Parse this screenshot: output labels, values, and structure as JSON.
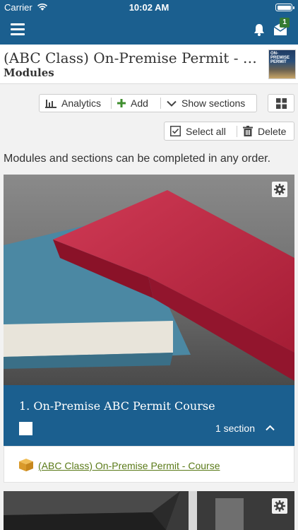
{
  "status_bar": {
    "carrier": "Carrier",
    "time": "10:02 AM"
  },
  "nav": {
    "mail_badge": "1",
    "icons": [
      "menu-icon",
      "bell-icon",
      "mail-icon"
    ]
  },
  "header": {
    "course_title": "(ABC Class) On-Premise Permit - Online",
    "subtitle": "Modules",
    "thumbnail_text": "ON-PREMISE PERMIT"
  },
  "toolbar": {
    "analytics_label": "Analytics",
    "add_label": "Add",
    "show_sections_label": "Show sections"
  },
  "toolbar2": {
    "select_all_label": "Select all",
    "delete_label": "Delete"
  },
  "info_text": "Modules and sections can be completed in any order.",
  "modules": [
    {
      "title": "1. On-Premise ABC Permit Course",
      "section_count": "1 section",
      "link": "(ABC Class) On-Premise Permit - Course"
    }
  ],
  "colors": {
    "brand": "#1b5f8f",
    "link": "#5a7a18",
    "badge": "#357a32",
    "box_icon": "#e0a83a"
  }
}
